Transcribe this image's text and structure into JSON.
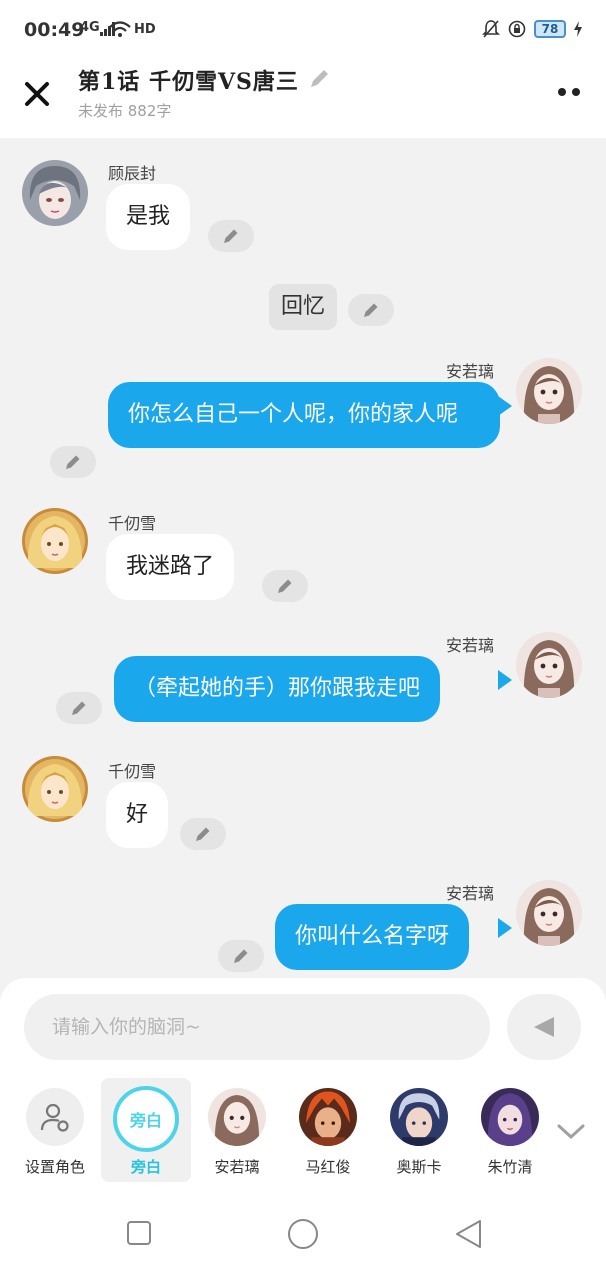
{
  "status_bar": {
    "time": "00:49",
    "network": "4G",
    "battery": "78"
  },
  "header": {
    "title": "第1话  千仞雪VS唐三",
    "subtitle": "未发布 882字"
  },
  "messages": [
    {
      "speaker": "顾辰封",
      "text": "是我",
      "side": "left"
    },
    {
      "text": "回忆",
      "side": "narration"
    },
    {
      "speaker": "安若璃",
      "text": "你怎么自己一个人呢，你的家人呢",
      "side": "right"
    },
    {
      "speaker": "千仞雪",
      "text": "我迷路了",
      "side": "left"
    },
    {
      "speaker": "安若璃",
      "text": "（牵起她的手）那你跟我走吧",
      "side": "right"
    },
    {
      "speaker": "千仞雪",
      "text": "好",
      "side": "left"
    },
    {
      "speaker": "安若璃",
      "text": "你叫什么名字呀",
      "side": "right"
    }
  ],
  "composer": {
    "placeholder": "请输入你的脑洞~"
  },
  "roles": [
    {
      "label": "设置角色"
    },
    {
      "label": "旁白",
      "selected": true,
      "badge": "旁白"
    },
    {
      "label": "安若璃"
    },
    {
      "label": "马红俊"
    },
    {
      "label": "奥斯卡"
    },
    {
      "label": "朱竹清"
    }
  ],
  "colors": {
    "accent": "#1aa7ec",
    "narration_ring": "#4dd4e8"
  }
}
